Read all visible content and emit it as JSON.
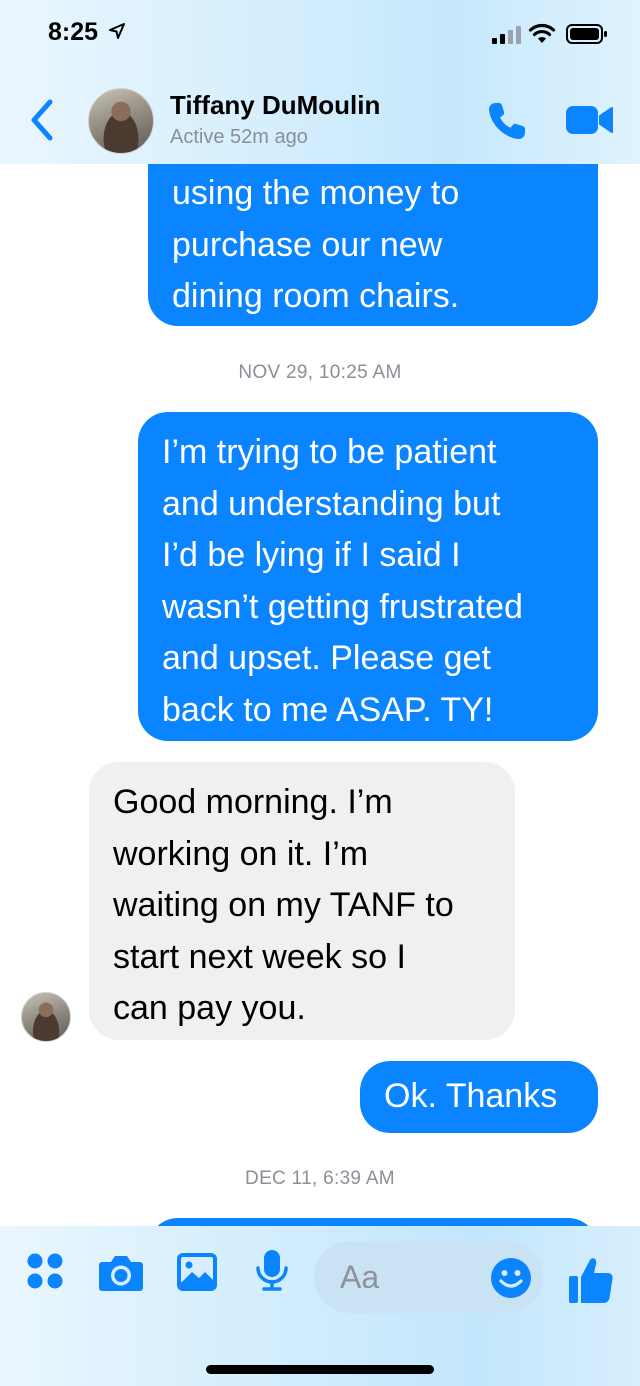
{
  "status_bar": {
    "time": "8:25"
  },
  "header": {
    "contact_name": "Tiffany DuMoulin",
    "contact_status": "Active 52m ago",
    "back_icon": "chevron-left-icon",
    "call_icon": "phone-icon",
    "video_icon": "video-camera-icon"
  },
  "messages": [
    {
      "sender": "me",
      "text": "using the money to\npurchase our new\ndining room chairs."
    },
    {
      "timestamp": "NOV 29, 10:25 AM"
    },
    {
      "sender": "me",
      "text": "I’m trying to be patient\nand understanding but\nI’d be lying if I said I\nwasn’t getting frustrated\nand upset. Please get\nback to me ASAP. TY!"
    },
    {
      "sender": "contact",
      "text": "Good morning. I’m\nworking on it. I’m\nwaiting on my TANF to\nstart next week so I\ncan pay you."
    },
    {
      "sender": "me",
      "text": "Ok. Thanks"
    },
    {
      "timestamp": "DEC 11, 6:39 AM"
    }
  ],
  "composer": {
    "placeholder": "Aa",
    "icons": [
      "more-icon",
      "camera-icon",
      "image-icon",
      "microphone-icon",
      "emoji-icon",
      "thumbs-up-icon"
    ]
  },
  "colors": {
    "outgoing_bubble": "#0a84ff",
    "incoming_bubble": "#f0f0f0",
    "accent": "#0a84ff",
    "timestamp_text": "#8a8f98"
  }
}
